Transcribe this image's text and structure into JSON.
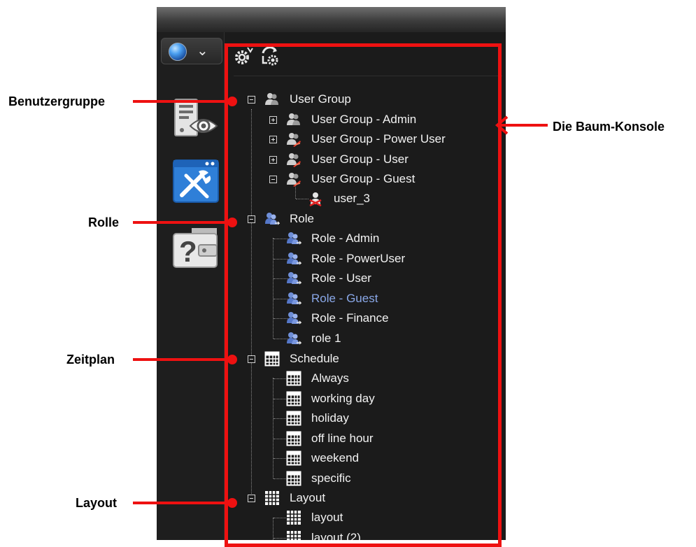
{
  "annotations": {
    "user_group": "Benutzergruppe",
    "role": "Rolle",
    "schedule": "Zeitplan",
    "layout": "Layout",
    "tree_console": "Die Baum-Konsole"
  },
  "colors": {
    "annotation_red": "#ee1111",
    "selected_text": "#8aa8e8",
    "panel_bg": "#1b1b1b"
  },
  "toolbar": {
    "icons": [
      "settings-icon",
      "refresh-settings-icon"
    ]
  },
  "sidebar": {
    "icons": [
      "globe-icon",
      "monitor-view-icon",
      "tools-icon",
      "help-icon"
    ]
  },
  "tree": {
    "user_group": {
      "label": "User Group",
      "children": [
        {
          "label": "User Group - Admin"
        },
        {
          "label": "User Group - Power User"
        },
        {
          "label": "User Group - User"
        },
        {
          "label": "User Group - Guest",
          "children": [
            {
              "label": "user_3"
            }
          ]
        }
      ]
    },
    "role": {
      "label": "Role",
      "children": [
        {
          "label": "Role - Admin"
        },
        {
          "label": "Role - PowerUser"
        },
        {
          "label": "Role - User"
        },
        {
          "label": "Role - Guest",
          "selected": true
        },
        {
          "label": "Role - Finance"
        },
        {
          "label": "role 1"
        }
      ]
    },
    "schedule": {
      "label": "Schedule",
      "children": [
        {
          "label": "Always"
        },
        {
          "label": "working day"
        },
        {
          "label": "holiday"
        },
        {
          "label": "off line hour"
        },
        {
          "label": "weekend"
        },
        {
          "label": "specific"
        }
      ]
    },
    "layout": {
      "label": "Layout",
      "children": [
        {
          "label": "layout"
        },
        {
          "label": "layout (2)"
        }
      ]
    }
  }
}
